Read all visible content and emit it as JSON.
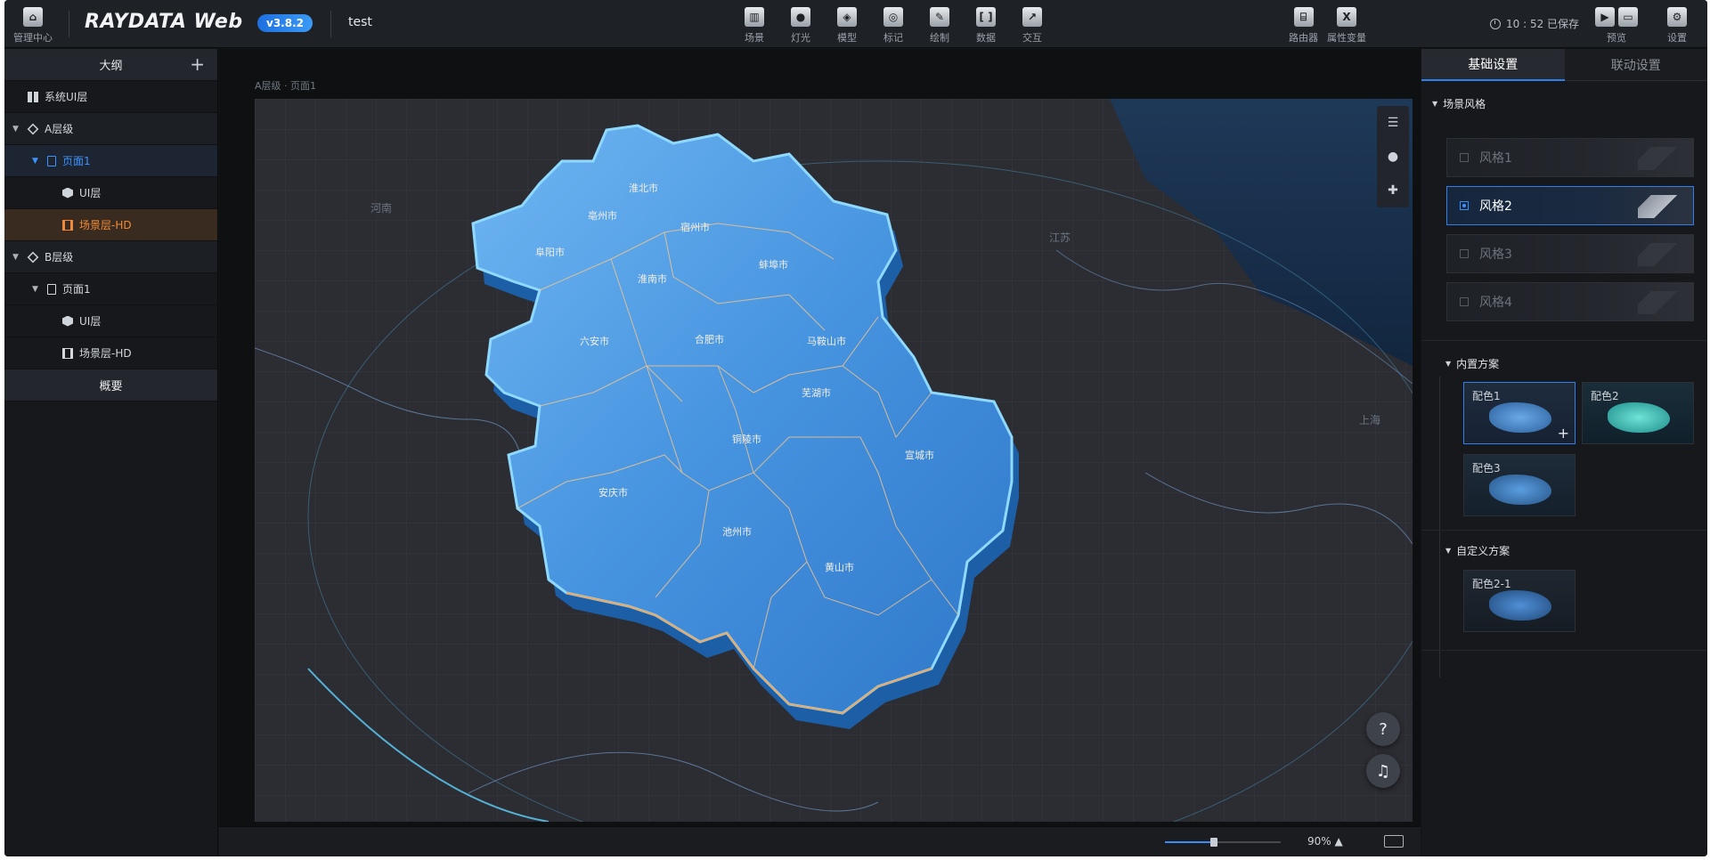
{
  "topbar": {
    "home_label": "管理中心",
    "logo": "RAYDATA Web",
    "version": "v3.8.2",
    "project_name": "test",
    "tools": [
      {
        "label": "场景",
        "icon": "scene-icon"
      },
      {
        "label": "灯光",
        "icon": "light-icon"
      },
      {
        "label": "模型",
        "icon": "model-icon"
      },
      {
        "label": "标记",
        "icon": "marker-icon"
      },
      {
        "label": "绘制",
        "icon": "draw-icon"
      },
      {
        "label": "数据",
        "icon": "data-icon"
      },
      {
        "label": "交互",
        "icon": "interaction-icon"
      }
    ],
    "router_label": "路由器",
    "attr_var_label": "属性变量",
    "saved_status": "10 : 52 已保存",
    "preview_label": "预览",
    "settings_label": "设置"
  },
  "outline": {
    "title": "大纲",
    "items": [
      {
        "label": "系统UI层"
      },
      {
        "label": "A层级"
      },
      {
        "label": "页面1"
      },
      {
        "label": "UI层"
      },
      {
        "label": "场景层-HD"
      },
      {
        "label": "B层级"
      },
      {
        "label": "页面1"
      },
      {
        "label": "UI层"
      },
      {
        "label": "场景层-HD"
      }
    ],
    "overview_title": "概要"
  },
  "canvas": {
    "breadcrumb": "A层级 · 页面1",
    "zoom": "90%",
    "zoom_value": 0.42,
    "cities": [
      "安庆市",
      "池州市",
      "黄山市",
      "宣城市",
      "铜陵市",
      "芜湖市",
      "马鞍山市",
      "合肥市",
      "六安市",
      "淮南市",
      "蚌埠市",
      "阜阳市",
      "亳州市",
      "宿州市",
      "淮北市"
    ],
    "region_labels": [
      "河南",
      "江苏",
      "上海"
    ]
  },
  "right_panel": {
    "tabs": [
      "基础设置",
      "联动设置"
    ],
    "scene_style_title": "场景风格",
    "styles": [
      "风格1",
      "风格2",
      "风格3",
      "风格4"
    ],
    "selected_style": "风格2",
    "builtin_title": "内置方案",
    "builtin_schemes": [
      "配色1",
      "配色2",
      "配色3"
    ],
    "custom_title": "自定义方案",
    "custom_schemes": [
      "配色2-1"
    ]
  },
  "colors": {
    "accent": "#2f80ed",
    "selected_layer": "#f08a38",
    "map_fill": "#3f8fe0",
    "map_edge": "#6ec8ff",
    "boundary": "#f2a65a"
  }
}
